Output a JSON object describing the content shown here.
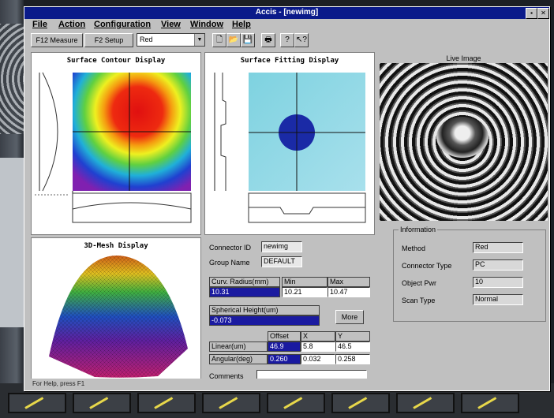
{
  "window": {
    "title": "Accis - [newimg]",
    "minimize": "▪",
    "close": "✕"
  },
  "menu": [
    "File",
    "Action",
    "Configuration",
    "View",
    "Window",
    "Help"
  ],
  "toolbar": {
    "measure": "F12 Measure",
    "setup": "F2 Setup",
    "color_select": "Red"
  },
  "panels": {
    "contour_title": "Surface Contour Display",
    "fitting_title": "Surface Fitting Display",
    "mesh_title": "3D-Mesh Display",
    "live_title": "Live Image"
  },
  "params": {
    "connector_id_label": "Connector ID",
    "connector_id": "newimg",
    "group_name_label": "Group Name",
    "group_name": "DEFAULT",
    "curv_label": "Curv. Radius(mm)",
    "min_label": "Min",
    "max_label": "Max",
    "curv_value": "10.31",
    "curv_min": "10.21",
    "curv_max": "10.47",
    "sph_label": "Spherical Height(um)",
    "sph_value": "-0.073",
    "more_button": "More",
    "offset_label": "Offset",
    "x_label": "X",
    "y_label": "Y",
    "linear_label": "Linear(um)",
    "linear_offset": "46.9",
    "linear_x": "5.8",
    "linear_y": "46.5",
    "angular_label": "Angular(deg)",
    "angular_offset": "0.260",
    "angular_x": "0.032",
    "angular_y": "0.258",
    "comments_label": "Comments",
    "comments_value": ""
  },
  "info": {
    "title": "Information",
    "rows": [
      {
        "label": "Method",
        "value": "Red"
      },
      {
        "label": "Connector Type",
        "value": "PC"
      },
      {
        "label": "Object Pwr",
        "value": "10"
      },
      {
        "label": "Scan Type",
        "value": "Normal"
      }
    ]
  },
  "status": "For Help, press F1"
}
